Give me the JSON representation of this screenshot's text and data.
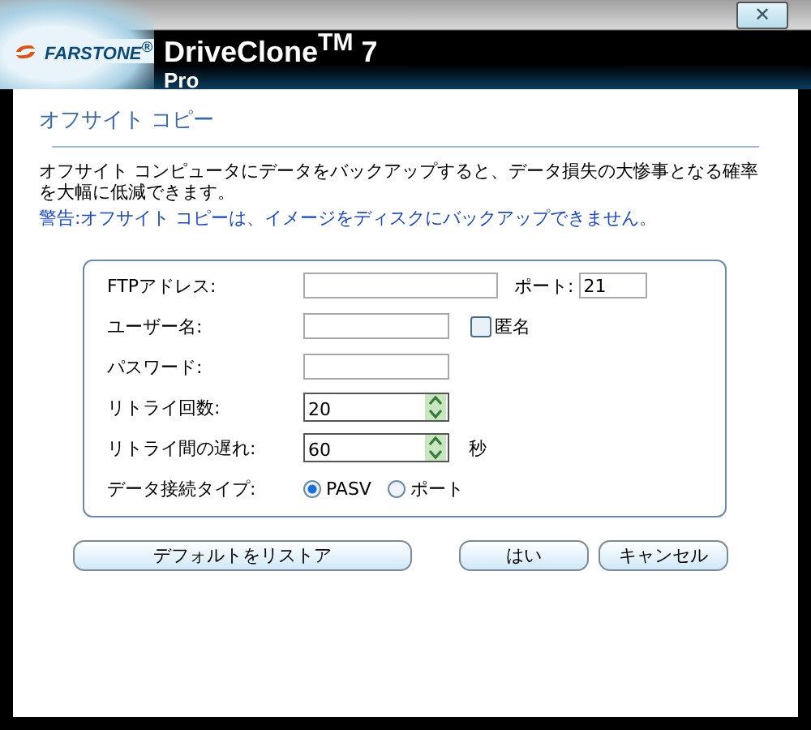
{
  "header": {
    "brand": "FARSTONE$^{®}$",
    "product": "DriveClone$^{TM}$ 7",
    "edition": "Pro",
    "close": "✕"
  },
  "section": {
    "title": "オフサイト コピー",
    "description": "オフサイト コンピュータにデータをバックアップすると、データ損失の大惨事となる確率を大幅に低減できます。",
    "warning": "警告:オフサイト コピーは、イメージをディスクにバックアップできません。"
  },
  "form": {
    "fields": [
      {
        "kind": "text",
        "label": "FTPアドレス:",
        "extra": {
          "kind": "port",
          "label": "ポート:",
          "value": "21"
        }
      },
      {
        "kind": "text",
        "label": "ユーザー名:",
        "extra": {
          "kind": "checkbox",
          "label": "匿名",
          "checked": false
        }
      },
      {
        "kind": "text",
        "label": "パスワード:"
      },
      {
        "kind": "spin",
        "label": "リトライ回数:",
        "value": "20"
      },
      {
        "kind": "spin",
        "label": "リトライ間の遅れ:",
        "value": "60",
        "unit": "秒"
      },
      {
        "kind": "radio",
        "label": "データ接続タイプ:",
        "options": [
          {
            "label": "PASV",
            "selected": true
          },
          {
            "label": "ポート",
            "selected": false
          }
        ]
      }
    ]
  },
  "buttons": {
    "restore": "デフォルトをリストア",
    "ok": "はい",
    "cancel": "キャンセル"
  }
}
